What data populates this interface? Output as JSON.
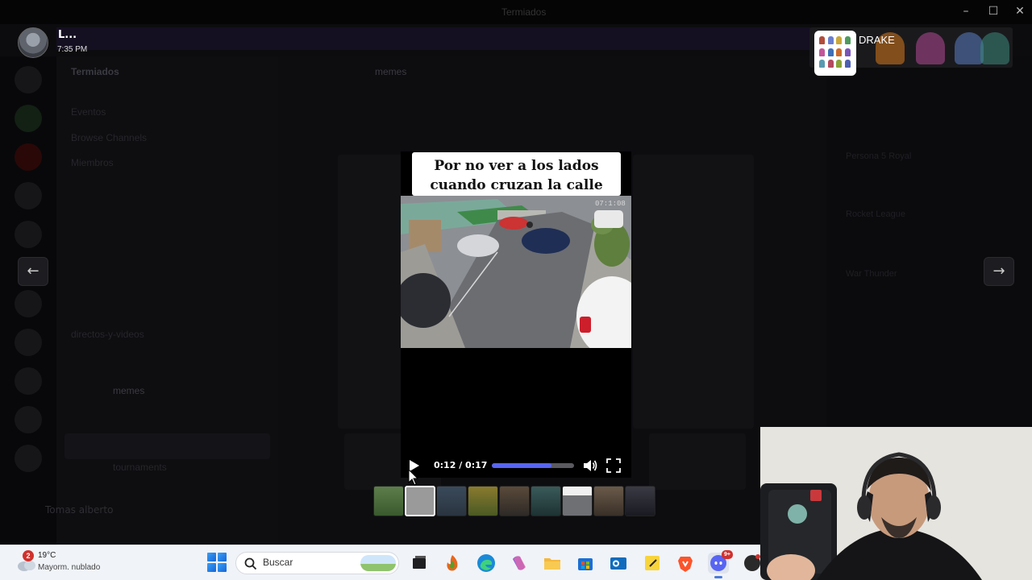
{
  "window": {
    "title": "Termiados"
  },
  "notification": {
    "username": "L...",
    "time": "7:35 PM"
  },
  "overlay": {
    "streamer_name": "DRAKE"
  },
  "viewer": {
    "caption": "Por no ver a los lados cuando cruzan la calle",
    "video_timestamp": "07:1:08",
    "time_display": "0:12 / 0:17",
    "progress": 0.73,
    "thumbnail_count": 9,
    "selected_thumbnail": 1
  },
  "background_ui": {
    "server_name": "Termiados",
    "active_channel": "memes",
    "channel_items": [
      "Eventos",
      "Browse Channels",
      "Miembros",
      "directos-y-videos",
      "memes",
      "tournaments"
    ],
    "user_panel_name": "Tomas alberto",
    "member_games": [
      "Persona 5 Royal",
      "Rocket League",
      "War Thunder"
    ]
  },
  "taskbar": {
    "weather_badge": "2",
    "temperature": "19°C",
    "condition": "Mayorm. nublado",
    "search_placeholder": "Buscar",
    "discord_badge": "9+"
  },
  "colors": {
    "accent": "#5865f2",
    "progress_track": "#5a5a60",
    "taskbar": "#f0f3f8",
    "badge": "#d0312d"
  }
}
